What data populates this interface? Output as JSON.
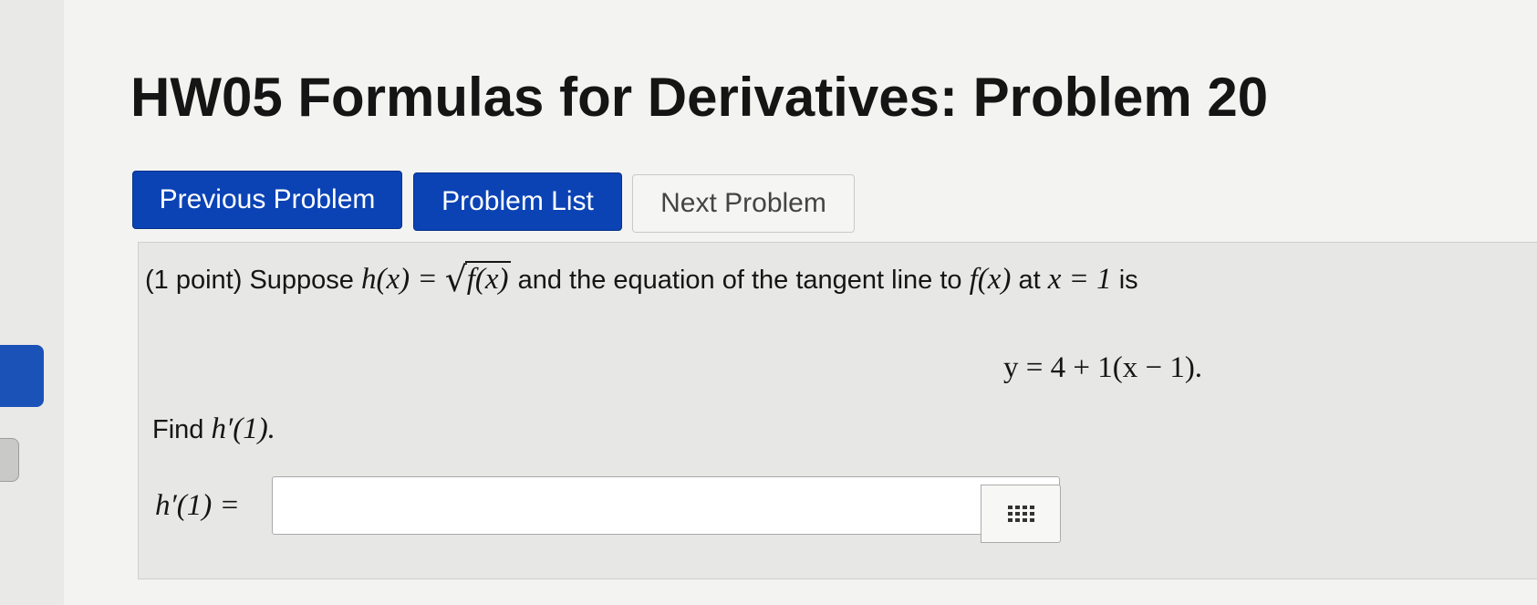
{
  "header": {
    "title": "HW05 Formulas for Derivatives: Problem 20"
  },
  "nav": {
    "previous_label": "Previous Problem",
    "list_label": "Problem List",
    "next_label": "Next Problem"
  },
  "problem": {
    "points": "(1 point)",
    "suppose": "Suppose",
    "h_def": "h(x) =",
    "sqrt_arg": "f(x)",
    "tangent_text": "and the equation of the tangent line to",
    "fx": "f(x)",
    "at": "at",
    "x_eq": "x = 1",
    "is": "is",
    "equation": "y = 4 + 1(x − 1).",
    "find": "Find",
    "find_expr": "h′(1).",
    "answer_label": "h′(1) ="
  },
  "answer": {
    "value": ""
  },
  "icons": {
    "palette": "grid-icon"
  }
}
